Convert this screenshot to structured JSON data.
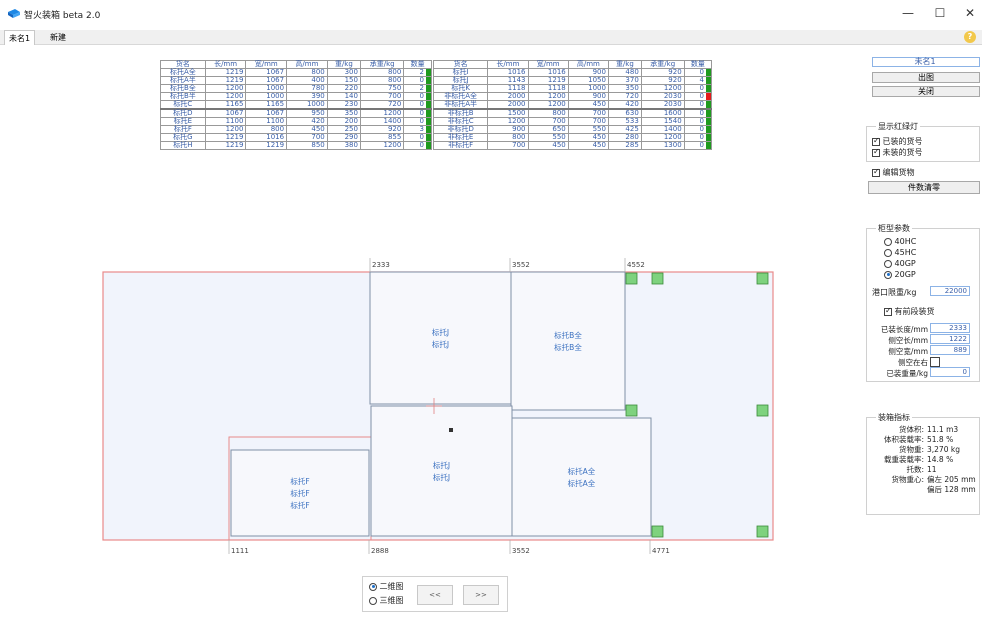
{
  "window": {
    "title": "智火装箱 beta 2.0",
    "minimize": "—",
    "maximize": "☐",
    "close": "✕"
  },
  "tabs": [
    {
      "label": "未名1"
    },
    {
      "label": "新建"
    }
  ],
  "help_label": "?",
  "goods_table": {
    "headers": [
      "货名",
      "长/mm",
      "宽/mm",
      "高/mm",
      "重/kg",
      "承重/kg",
      "数量"
    ],
    "left_rows": [
      {
        "name": "标托A全",
        "l": "1219",
        "w": "1067",
        "h": "800",
        "wt": "300",
        "load": "800",
        "qty": "2",
        "status": "green"
      },
      {
        "name": "标托A半",
        "l": "1219",
        "w": "1067",
        "h": "400",
        "wt": "150",
        "load": "800",
        "qty": "0",
        "status": "green"
      },
      {
        "name": "标托B全",
        "l": "1200",
        "w": "1000",
        "h": "780",
        "wt": "220",
        "load": "750",
        "qty": "2",
        "status": "green"
      },
      {
        "name": "标托B半",
        "l": "1200",
        "w": "1000",
        "h": "390",
        "wt": "140",
        "load": "700",
        "qty": "0",
        "status": "green"
      },
      {
        "name": "标托C",
        "l": "1165",
        "w": "1165",
        "h": "1000",
        "wt": "230",
        "load": "720",
        "qty": "0",
        "status": "green"
      },
      {
        "name": "标托D",
        "l": "1067",
        "w": "1067",
        "h": "950",
        "wt": "350",
        "load": "1200",
        "qty": "0",
        "status": "green"
      },
      {
        "name": "标托E",
        "l": "1100",
        "w": "1100",
        "h": "420",
        "wt": "200",
        "load": "1400",
        "qty": "0",
        "status": "green"
      },
      {
        "name": "标托F",
        "l": "1200",
        "w": "800",
        "h": "450",
        "wt": "250",
        "load": "920",
        "qty": "3",
        "status": "green"
      },
      {
        "name": "标托G",
        "l": "1219",
        "w": "1016",
        "h": "700",
        "wt": "290",
        "load": "855",
        "qty": "0",
        "status": "green"
      },
      {
        "name": "标托H",
        "l": "1219",
        "w": "1219",
        "h": "850",
        "wt": "380",
        "load": "1200",
        "qty": "0",
        "status": "green"
      }
    ],
    "right_rows": [
      {
        "name": "标托I",
        "l": "1016",
        "w": "1016",
        "h": "900",
        "wt": "480",
        "load": "920",
        "qty": "0",
        "status": "green"
      },
      {
        "name": "标托J",
        "l": "1143",
        "w": "1219",
        "h": "1050",
        "wt": "370",
        "load": "920",
        "qty": "4",
        "status": "green"
      },
      {
        "name": "标托K",
        "l": "1118",
        "w": "1118",
        "h": "1000",
        "wt": "350",
        "load": "1200",
        "qty": "0",
        "status": "green"
      },
      {
        "name": "非标托A全",
        "l": "2000",
        "w": "1200",
        "h": "900",
        "wt": "720",
        "load": "2030",
        "qty": "0",
        "status": "red"
      },
      {
        "name": "非标托A半",
        "l": "2000",
        "w": "1200",
        "h": "450",
        "wt": "420",
        "load": "2030",
        "qty": "0",
        "status": "green"
      },
      {
        "name": "非标托B",
        "l": "1500",
        "w": "800",
        "h": "700",
        "wt": "630",
        "load": "1600",
        "qty": "0",
        "status": "green"
      },
      {
        "name": "非标托C",
        "l": "1200",
        "w": "700",
        "h": "700",
        "wt": "533",
        "load": "1540",
        "qty": "0",
        "status": "green"
      },
      {
        "name": "非标托D",
        "l": "900",
        "w": "650",
        "h": "550",
        "wt": "425",
        "load": "1400",
        "qty": "0",
        "status": "green"
      },
      {
        "name": "非标托E",
        "l": "800",
        "w": "550",
        "h": "450",
        "wt": "280",
        "load": "1200",
        "qty": "0",
        "status": "green"
      },
      {
        "name": "非标托F",
        "l": "700",
        "w": "450",
        "h": "450",
        "wt": "285",
        "load": "1300",
        "qty": "0",
        "status": "green"
      }
    ]
  },
  "right_panel": {
    "name_input": "未名1",
    "export_label": "出图",
    "close_label": "关闭",
    "indicator_group_title": "显示红绿灯",
    "loaded_label": "已装的货号",
    "unloaded_label": "未装的货号",
    "edit_label": "编辑货物",
    "reset_label": "件数清零",
    "container_group_title": "柜型参数",
    "container_types": [
      {
        "label": "40HC",
        "selected": false
      },
      {
        "label": "45HC",
        "selected": false
      },
      {
        "label": "40GP",
        "selected": false
      },
      {
        "label": "20GP",
        "selected": true
      }
    ],
    "port_limit_label": "港口限重/kg",
    "port_limit_value": "22000",
    "front_loaded_label": "有前段装货",
    "loaded_length_label": "已装长度/mm",
    "loaded_length_value": "2333",
    "side_length_label": "侧空长/mm",
    "side_length_value": "1222",
    "side_width_label": "侧空宽/mm",
    "side_width_value": "889",
    "side_right_label": "侧空在右",
    "loaded_weight_label": "已装重量/kg",
    "loaded_weight_value": "0",
    "stats_group_title": "装箱指标",
    "stats": [
      {
        "label": "货体积:",
        "value": "11.1 m3"
      },
      {
        "label": "体积装载率:",
        "value": "51.8 %"
      },
      {
        "label": "货物重:",
        "value": "3,270 kg"
      },
      {
        "label": "载重装载率:",
        "value": "14.8 %"
      },
      {
        "label": "托数:",
        "value": "11"
      },
      {
        "label": "货物重心:",
        "value": "偏左 205 mm"
      },
      {
        "label": "",
        "value": "偏后 128 mm"
      }
    ]
  },
  "layout_view": {
    "top_ticks": [
      "2333",
      "3552",
      "4552"
    ],
    "bottom_ticks": [
      "1111",
      "2888",
      "3552",
      "4771"
    ],
    "box_labels": {
      "box_j_top": [
        "标托J",
        "标托J"
      ],
      "box_b": [
        "标托B全",
        "标托B全"
      ],
      "box_f": [
        "标托F",
        "标托F",
        "标托F"
      ],
      "box_j_bottom": [
        "标托J",
        "标托J"
      ],
      "box_a": [
        "标托A全",
        "标托A全"
      ]
    },
    "colors": {
      "container_border": "#e88a8a",
      "container_fill": "#f1f4fc",
      "box_border": "#7f8fa6",
      "box_text": "#3a70c0",
      "marker": "#7ed27e"
    }
  },
  "view_controls": {
    "view_2d_label": "二维图",
    "view_3d_label": "三维图",
    "prev_label": "<<",
    "next_label": ">>"
  }
}
